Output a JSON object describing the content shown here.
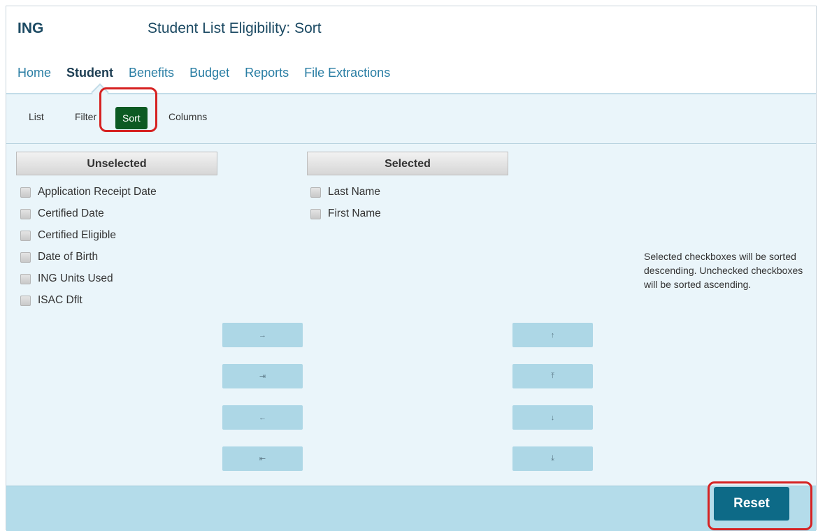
{
  "app": {
    "name": "ING",
    "title": "Student List Eligibility: Sort"
  },
  "main_nav": {
    "items": [
      {
        "label": "Home",
        "active": false
      },
      {
        "label": "Student",
        "active": true
      },
      {
        "label": "Benefits",
        "active": false
      },
      {
        "label": "Budget",
        "active": false
      },
      {
        "label": "Reports",
        "active": false
      },
      {
        "label": "File Extractions",
        "active": false
      }
    ]
  },
  "sub_nav": {
    "items": [
      {
        "label": "List",
        "active": false
      },
      {
        "label": "Filter",
        "active": false
      },
      {
        "label": "Sort",
        "active": true
      },
      {
        "label": "Columns",
        "active": false
      }
    ]
  },
  "unselected": {
    "header": "Unselected",
    "items": [
      "Application Receipt Date",
      "Certified Date",
      "Certified Eligible",
      "Date of Birth",
      "ING Units Used",
      "ISAC Dflt"
    ]
  },
  "selected": {
    "header": "Selected",
    "items": [
      "Last Name",
      "First Name"
    ]
  },
  "transfer_buttons": {
    "move_right": "→",
    "move_all_right": "⇥",
    "move_left": "←",
    "move_all_left": "⇤"
  },
  "order_buttons": {
    "move_up": "↑",
    "move_top": "⤒",
    "move_down": "↓",
    "move_bottom": "⤓"
  },
  "info_note": "Selected checkboxes will be sorted descending. Unchecked checkboxes will be sorted ascending.",
  "footer": {
    "reset_label": "Reset"
  },
  "colors": {
    "brand_text": "#1c4a63",
    "nav_link": "#2a7ea4",
    "active_sort": "#0c5a23",
    "content_bg": "#eaf5fa",
    "button_bg": "#add7e6",
    "reset_bg": "#0d6a87",
    "highlight": "#d62222"
  }
}
